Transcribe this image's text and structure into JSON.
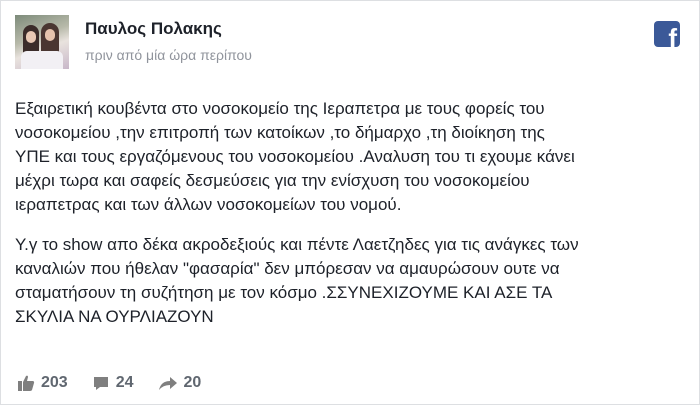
{
  "post": {
    "author": "Παυλος Πολακης",
    "timestamp": "πριν από μία ώρα περίπου",
    "paragraphs": [
      {
        "lines": [
          "Εξαιρετική κουβέντα στο νοσοκομείο της Ιεραπετρα με τους φορείς του",
          "νοσοκομείου ,την επιτροπή των κατοίκων ,το δήμαρχο ,τη διοίκηση της",
          "ΥΠΕ και τους εργαζόμενους του νοσοκομείου .Αναλυση του τι εχουμε κάνει",
          "μέχρι τωρα και σαφείς δεσμεύσεις για την ενίσχυση του νοσοκομείου",
          "ιεραπετρας και των άλλων νοσοκομείων του νομού."
        ]
      },
      {
        "lines": [
          "Υ.γ το show απο δέκα ακροδεξιούς και πέντε Λαετζηδες για τις ανάγκες των",
          "καναλιών που ήθελαν \"φασαρία\" δεν μπόρεσαν να αμαυρώσουν ουτε να",
          "σταματήσουν τη συζήτηση με τον κόσμο .ΣΣΥΝΕΧΙΖΟΥΜΕ ΚΑΙ ΑΣΕ ΤΑ",
          "ΣΚΥΛΙΑ ΝΑ ΟΥΡΛΙΑΖΟΥΝ"
        ]
      }
    ]
  },
  "stats": {
    "likes": "203",
    "comments": "24",
    "shares": "20"
  },
  "brand": {
    "logo_letter": "f",
    "logo_color": "#3b5998"
  },
  "icons": {
    "like": "thumbs-up-icon",
    "comment": "comment-icon",
    "share": "share-arrow-icon"
  }
}
